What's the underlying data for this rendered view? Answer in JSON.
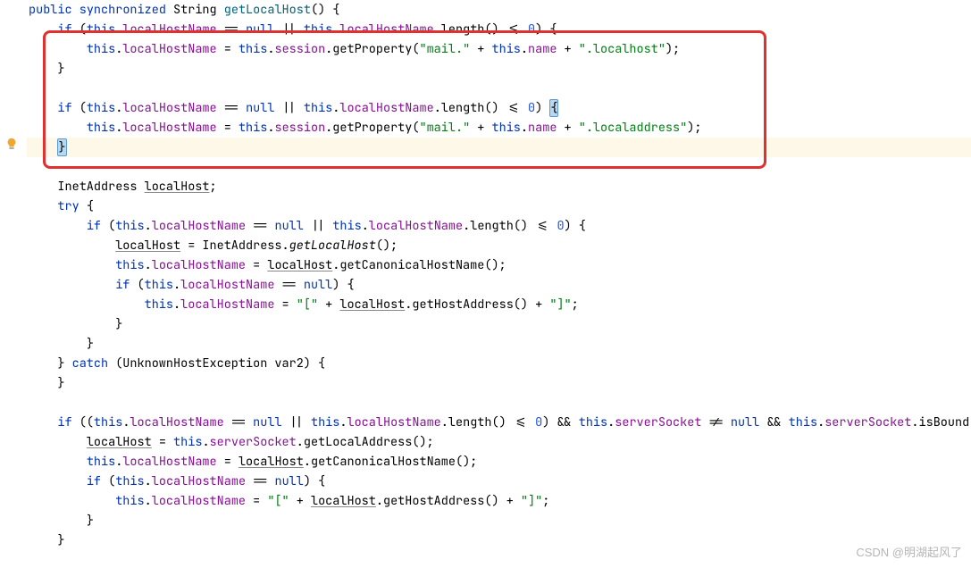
{
  "code": {
    "sig": {
      "kw1": "public",
      "kw2": "synchronized",
      "type_ret": "String",
      "name": "getLocalHost",
      "parens": "()",
      "brace": "{"
    },
    "l2": {
      "kw_if": "if",
      "p1": "(",
      "kw_this1": "this",
      "dot1": ".",
      "f1": "localHostName",
      "eq": " == ",
      "kw_null1": "null",
      "or": " || ",
      "kw_this2": "this",
      "dot2": ".",
      "f2": "localHostName",
      "dot3": ".",
      "m": "length()",
      "cmp": " <= ",
      "num": "0",
      "p2": ")",
      "brace": " {"
    },
    "l3": {
      "kw_this1": "this",
      "dot1": ".",
      "f1": "localHostName",
      "eq": " = ",
      "kw_this2": "this",
      "dot2": ".",
      "f2": "session",
      "dot3": ".",
      "m": "getProperty(",
      "s1": "\"mail.\"",
      "plus1": " + ",
      "kw_this3": "this",
      "dot4": ".",
      "f3": "name",
      "plus2": " + ",
      "s2": "\".localhost\"",
      "close": ");"
    },
    "l4": {
      "brace": "}"
    },
    "l6": {
      "kw_if": "if",
      "p1": "(",
      "kw_this1": "this",
      "dot1": ".",
      "f1": "localHostName",
      "eq": " == ",
      "kw_null1": "null",
      "or": " || ",
      "kw_this2": "this",
      "dot2": ".",
      "f2": "localHostName",
      "dot3": ".",
      "m": "length()",
      "cmp": " <= ",
      "num": "0",
      "p2": ") ",
      "brace": "{"
    },
    "l7": {
      "kw_this1": "this",
      "dot1": ".",
      "f1": "localHostName",
      "eq": " = ",
      "kw_this2": "this",
      "dot2": ".",
      "f2": "session",
      "dot3": ".",
      "m": "getProperty(",
      "s1": "\"mail.\"",
      "plus1": " + ",
      "kw_this3": "this",
      "dot4": ".",
      "f3": "name",
      "plus2": " + ",
      "s2": "\".localaddress\"",
      "close": ");"
    },
    "l8": {
      "brace": "}"
    },
    "l10": {
      "type": "InetAddress ",
      "var": "localHost",
      "semi": ";"
    },
    "l11": {
      "kw": "try",
      "brace": " {"
    },
    "l12": {
      "kw_if": "if",
      "p1": "(",
      "kw_this1": "this",
      "dot1": ".",
      "f1": "localHostName",
      "eq": " == ",
      "kw_null1": "null",
      "or": " || ",
      "kw_this2": "this",
      "dot2": ".",
      "f2": "localHostName",
      "dot3": ".",
      "m": "length()",
      "cmp": " <= ",
      "num": "0",
      "p2": ") {"
    },
    "l13": {
      "var": "localHost",
      "eq": " = InetAddress.",
      "m": "getLocalHost",
      "close": "();"
    },
    "l14": {
      "kw_this1": "this",
      "dot1": ".",
      "f1": "localHostName",
      "eq": " = ",
      "var": "localHost",
      "dot2": ".",
      "m": "getCanonicalHostName();"
    },
    "l15": {
      "kw_if": "if",
      "p1": "(",
      "kw_this1": "this",
      "dot1": ".",
      "f1": "localHostName",
      "eq": " == ",
      "kw_null": "null",
      "p2": ") {"
    },
    "l16": {
      "kw_this1": "this",
      "dot1": ".",
      "f1": "localHostName",
      "eq": " = ",
      "s1": "\"[\"",
      "plus1": " + ",
      "var": "localHost",
      "dot2": ".",
      "m": "getHostAddress()",
      "plus2": " + ",
      "s2": "\"]\"",
      "semi": ";"
    },
    "l17": {
      "brace": "}"
    },
    "l18": {
      "brace": "}"
    },
    "l19": {
      "b1": "} ",
      "kw": "catch",
      "p": " (UnknownHostException var2) {"
    },
    "l20": {
      "brace": "}"
    },
    "l22": {
      "kw_if": "if",
      "p1": " ((",
      "kw_this1": "this",
      "dot1": ".",
      "f1": "localHostName",
      "eq": " == ",
      "kw_null1": "null",
      "or": " || ",
      "kw_this2": "this",
      "dot2": ".",
      "f2": "localHostName",
      "dot3": ".",
      "m": "length()",
      "cmp": " <= ",
      "num": "0",
      "p2": ") && ",
      "kw_this3": "this",
      "dot4": ".",
      "f3": "serverSocket",
      "ne": " != ",
      "kw_null2": "null",
      "and": " && ",
      "kw_this4": "this",
      "dot5": ".",
      "f4": "serverSocket",
      "dot6": ".",
      "m2": "isBound()"
    },
    "l23": {
      "var": "localHost",
      "eq": " = ",
      "kw_this": "this",
      "dot": ".",
      "f": "serverSocket",
      "dot2": ".",
      "m": "getLocalAddress();"
    },
    "l24": {
      "kw_this1": "this",
      "dot1": ".",
      "f1": "localHostName",
      "eq": " = ",
      "var": "localHost",
      "dot2": ".",
      "m": "getCanonicalHostName();"
    },
    "l25": {
      "kw_if": "if",
      "p1": "(",
      "kw_this1": "this",
      "dot1": ".",
      "f1": "localHostName",
      "eq": " == ",
      "kw_null": "null",
      "p2": ") {"
    },
    "l26": {
      "kw_this1": "this",
      "dot1": ".",
      "f1": "localHostName",
      "eq": " = ",
      "s1": "\"[\"",
      "plus1": " + ",
      "var": "localHost",
      "dot2": ".",
      "m": "getHostAddress()",
      "plus2": " + ",
      "s2": "\"]\"",
      "semi": ";"
    },
    "l27": {
      "brace": "}"
    },
    "l28": {
      "brace": "}"
    }
  },
  "watermark": "CSDN @明湖起风了"
}
